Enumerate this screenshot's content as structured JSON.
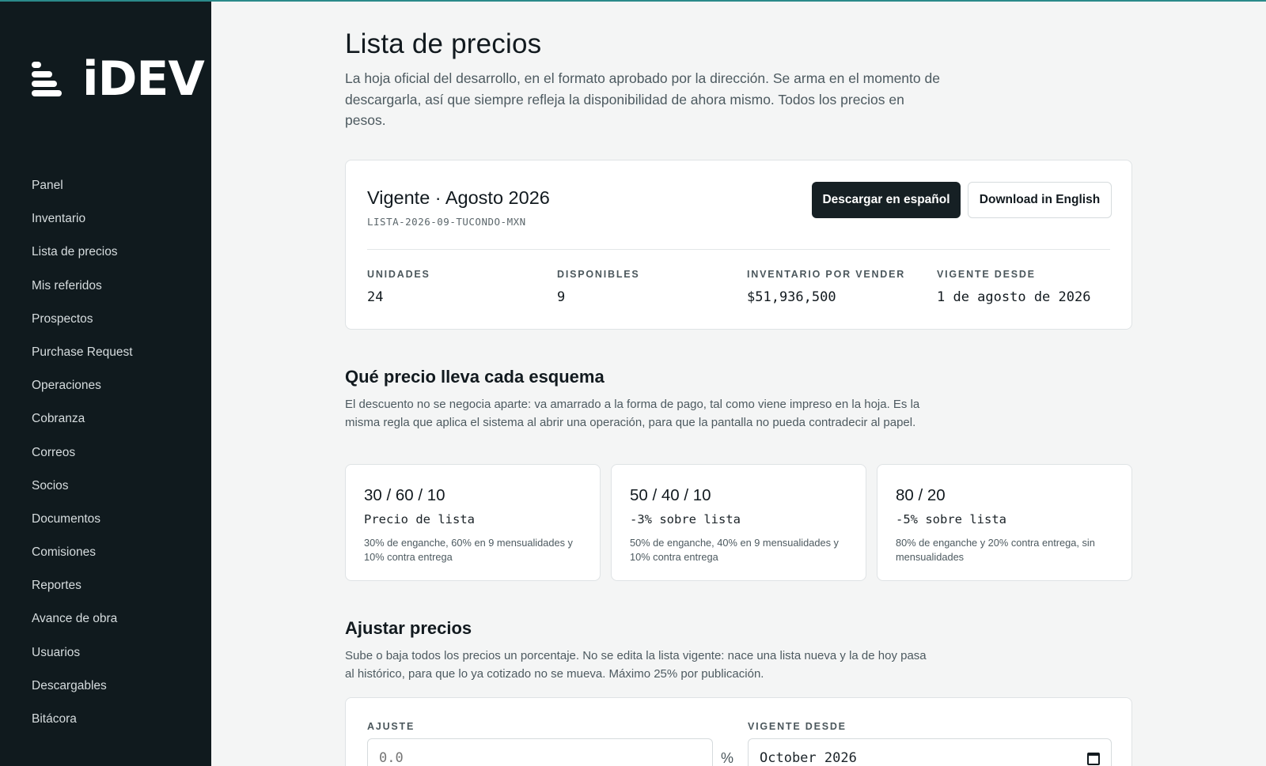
{
  "app": {
    "logo_text": "iDEV"
  },
  "sidebar": {
    "items": [
      {
        "label": "Panel"
      },
      {
        "label": "Inventario"
      },
      {
        "label": "Lista de precios"
      },
      {
        "label": "Mis referidos"
      },
      {
        "label": "Prospectos"
      },
      {
        "label": "Purchase Request"
      },
      {
        "label": "Operaciones"
      },
      {
        "label": "Cobranza"
      },
      {
        "label": "Correos"
      },
      {
        "label": "Socios"
      },
      {
        "label": "Documentos"
      },
      {
        "label": "Comisiones"
      },
      {
        "label": "Reportes"
      },
      {
        "label": "Avance de obra"
      },
      {
        "label": "Usuarios"
      },
      {
        "label": "Descargables"
      },
      {
        "label": "Bitácora"
      }
    ]
  },
  "page": {
    "title": "Lista de precios",
    "description": "La hoja oficial del desarrollo, en el formato aprobado por la dirección. Se arma en el momento de descargarla, así que siempre refleja la disponibilidad de ahora mismo. Todos los precios en pesos."
  },
  "current_list": {
    "title": "Vigente · Agosto 2026",
    "code": "LISTA-2026-09-TUCONDO-MXN",
    "download_es_label": "Descargar en español",
    "download_en_label": "Download in English",
    "stats": [
      {
        "label": "UNIDADES",
        "value": "24"
      },
      {
        "label": "DISPONIBLES",
        "value": "9"
      },
      {
        "label": "INVENTARIO POR VENDER",
        "value": "$51,936,500"
      },
      {
        "label": "VIGENTE DESDE",
        "value": "1 de agosto de 2026"
      }
    ]
  },
  "schemes_section": {
    "title": "Qué precio lleva cada esquema",
    "description": "El descuento no se negocia aparte: va amarrado a la forma de pago, tal como viene impreso en la hoja. Es la misma regla que aplica el sistema al abrir una operación, para que la pantalla no pueda contradecir al papel.",
    "schemes": [
      {
        "title": "30 / 60 / 10",
        "price": "Precio de lista",
        "description": "30% de enganche, 60% en 9 mensualidades y 10% contra entrega"
      },
      {
        "title": "50 / 40 / 10",
        "price": "-3% sobre lista",
        "description": "50% de enganche, 40% en 9 mensualidades y 10% contra entrega"
      },
      {
        "title": "80 / 20",
        "price": "-5% sobre lista",
        "description": "80% de enganche y 20% contra entrega, sin mensualidades"
      }
    ]
  },
  "adjust_section": {
    "title": "Ajustar precios",
    "description": "Sube o baja todos los precios un porcentaje. No se edita la lista vigente: nace una lista nueva y la de hoy pasa al histórico, para que lo ya cotizado no se mueva. Máximo 25% por publicación.",
    "adjust_label": "AJUSTE",
    "adjust_placeholder": "0.0",
    "percent_symbol": "%",
    "effective_label": "VIGENTE DESDE",
    "effective_value": "October 2026"
  }
}
